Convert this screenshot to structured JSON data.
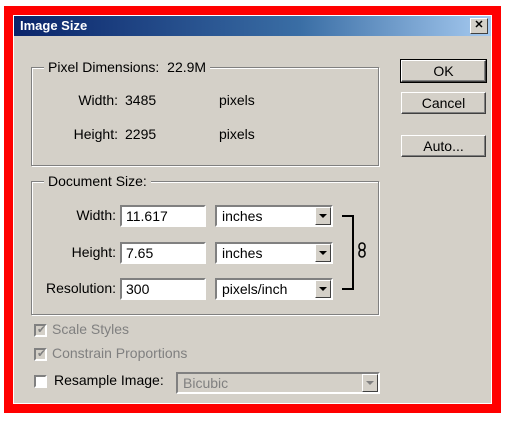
{
  "window": {
    "title": "Image Size",
    "close_glyph": "✕"
  },
  "pixel_dimensions": {
    "legend": "Pixel Dimensions:",
    "size": "22.9M",
    "width_label": "Width:",
    "width_value": "3485",
    "width_unit": "pixels",
    "height_label": "Height:",
    "height_value": "2295",
    "height_unit": "pixels"
  },
  "buttons": {
    "ok": "OK",
    "cancel": "Cancel",
    "auto": "Auto..."
  },
  "document_size": {
    "legend": "Document Size:",
    "width_label": "Width:",
    "width_value": "11.617",
    "width_unit": "inches",
    "height_label": "Height:",
    "height_value": "7.65",
    "height_unit": "inches",
    "resolution_label": "Resolution:",
    "resolution_value": "300",
    "resolution_unit": "pixels/inch",
    "link_icon": "chain-link"
  },
  "options": {
    "scale_styles": {
      "label": "Scale Styles",
      "checked": true,
      "enabled": false
    },
    "constrain_proportions": {
      "label": "Constrain Proportions",
      "checked": true,
      "enabled": false
    },
    "resample_image": {
      "label": "Resample Image:",
      "checked": false,
      "enabled": true
    },
    "resample_method": {
      "value": "Bicubic",
      "enabled": false
    }
  },
  "colors": {
    "frame": "#ff0000",
    "dialog_bg": "#d4d0c8",
    "titlebar": "#0a246a"
  }
}
